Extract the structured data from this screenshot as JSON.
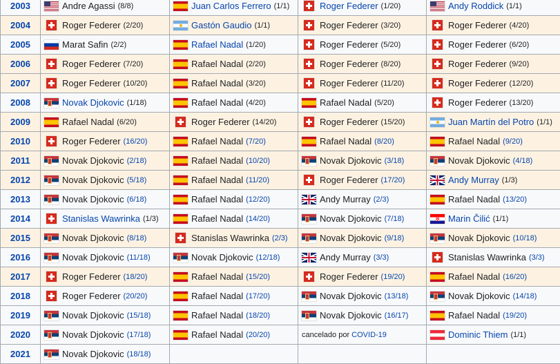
{
  "rows": [
    {
      "year": "2003",
      "cells": [
        {
          "flag": "usa",
          "name": "Andre Agassi",
          "count": "(8/8)",
          "name_link": false,
          "count_link": false
        },
        {
          "flag": "esp",
          "name": "Juan Carlos Ferrero",
          "count": "(1/1)",
          "name_link": true,
          "count_link": false
        },
        {
          "flag": "sui",
          "name": "Roger Federer",
          "count": "(1/20)",
          "name_link": true,
          "count_link": false
        },
        {
          "flag": "usa",
          "name": "Andy Roddick",
          "count": "(1/1)",
          "name_link": true,
          "count_link": false
        }
      ]
    },
    {
      "year": "2004",
      "cells": [
        {
          "flag": "sui",
          "name": "Roger Federer",
          "count": "(2/20)",
          "name_link": false,
          "count_link": false
        },
        {
          "flag": "arg",
          "name": "Gastón Gaudio",
          "count": "(1/1)",
          "name_link": true,
          "count_link": false
        },
        {
          "flag": "sui",
          "name": "Roger Federer",
          "count": "(3/20)",
          "name_link": false,
          "count_link": false
        },
        {
          "flag": "sui",
          "name": "Roger Federer",
          "count": "(4/20)",
          "name_link": false,
          "count_link": false
        }
      ]
    },
    {
      "year": "2005",
      "cells": [
        {
          "flag": "rus",
          "name": "Marat Safin",
          "count": "(2/2)",
          "name_link": false,
          "count_link": false
        },
        {
          "flag": "esp",
          "name": "Rafael Nadal",
          "count": "(1/20)",
          "name_link": true,
          "count_link": false
        },
        {
          "flag": "sui",
          "name": "Roger Federer",
          "count": "(5/20)",
          "name_link": false,
          "count_link": false
        },
        {
          "flag": "sui",
          "name": "Roger Federer",
          "count": "(6/20)",
          "name_link": false,
          "count_link": false
        }
      ]
    },
    {
      "year": "2006",
      "cells": [
        {
          "flag": "sui",
          "name": "Roger Federer",
          "count": "(7/20)",
          "name_link": false,
          "count_link": false
        },
        {
          "flag": "esp",
          "name": "Rafael Nadal",
          "count": "(2/20)",
          "name_link": false,
          "count_link": false
        },
        {
          "flag": "sui",
          "name": "Roger Federer",
          "count": "(8/20)",
          "name_link": false,
          "count_link": false
        },
        {
          "flag": "sui",
          "name": "Roger Federer",
          "count": "(9/20)",
          "name_link": false,
          "count_link": false
        }
      ]
    },
    {
      "year": "2007",
      "cells": [
        {
          "flag": "sui",
          "name": "Roger Federer",
          "count": "(10/20)",
          "name_link": false,
          "count_link": false
        },
        {
          "flag": "esp",
          "name": "Rafael Nadal",
          "count": "(3/20)",
          "name_link": false,
          "count_link": false
        },
        {
          "flag": "sui",
          "name": "Roger Federer",
          "count": "(11/20)",
          "name_link": false,
          "count_link": false
        },
        {
          "flag": "sui",
          "name": "Roger Federer",
          "count": "(12/20)",
          "name_link": false,
          "count_link": false
        }
      ]
    },
    {
      "year": "2008",
      "cells": [
        {
          "flag": "srb",
          "name": "Novak Djokovic",
          "count": "(1/18)",
          "name_link": true,
          "count_link": false
        },
        {
          "flag": "esp",
          "name": "Rafael Nadal",
          "count": "(4/20)",
          "name_link": false,
          "count_link": false
        },
        {
          "flag": "esp",
          "name": "Rafael Nadal",
          "count": "(5/20)",
          "name_link": false,
          "count_link": false
        },
        {
          "flag": "sui",
          "name": "Roger Federer",
          "count": "(13/20)",
          "name_link": false,
          "count_link": false
        }
      ]
    },
    {
      "year": "2009",
      "cells": [
        {
          "flag": "esp",
          "name": "Rafael Nadal",
          "count": "(6/20)",
          "name_link": false,
          "count_link": false
        },
        {
          "flag": "sui",
          "name": "Roger Federer",
          "count": "(14/20)",
          "name_link": false,
          "count_link": false
        },
        {
          "flag": "sui",
          "name": "Roger Federer",
          "count": "(15/20)",
          "name_link": false,
          "count_link": false
        },
        {
          "flag": "arg",
          "name": "Juan Martín del Potro",
          "count": "(1/1)",
          "name_link": true,
          "count_link": false
        }
      ]
    },
    {
      "year": "2010",
      "cells": [
        {
          "flag": "sui",
          "name": "Roger Federer",
          "count": "(16/20)",
          "name_link": false,
          "count_link": true
        },
        {
          "flag": "esp",
          "name": "Rafael Nadal",
          "count": "(7/20)",
          "name_link": false,
          "count_link": true
        },
        {
          "flag": "esp",
          "name": "Rafael Nadal",
          "count": "(8/20)",
          "name_link": false,
          "count_link": true
        },
        {
          "flag": "esp",
          "name": "Rafael Nadal",
          "count": "(9/20)",
          "name_link": false,
          "count_link": true
        }
      ]
    },
    {
      "year": "2011",
      "cells": [
        {
          "flag": "srb",
          "name": "Novak Djokovic",
          "count": "(2/18)",
          "name_link": false,
          "count_link": true
        },
        {
          "flag": "esp",
          "name": "Rafael Nadal",
          "count": "(10/20)",
          "name_link": false,
          "count_link": true
        },
        {
          "flag": "srb",
          "name": "Novak Djokovic",
          "count": "(3/18)",
          "name_link": false,
          "count_link": true
        },
        {
          "flag": "srb",
          "name": "Novak Djokovic",
          "count": "(4/18)",
          "name_link": false,
          "count_link": true
        }
      ]
    },
    {
      "year": "2012",
      "cells": [
        {
          "flag": "srb",
          "name": "Novak Djokovic",
          "count": "(5/18)",
          "name_link": false,
          "count_link": true
        },
        {
          "flag": "esp",
          "name": "Rafael Nadal",
          "count": "(11/20)",
          "name_link": false,
          "count_link": true
        },
        {
          "flag": "sui",
          "name": "Roger Federer",
          "count": "(17/20)",
          "name_link": false,
          "count_link": true
        },
        {
          "flag": "gbr",
          "name": "Andy Murray",
          "count": "(1/3)",
          "name_link": true,
          "count_link": false
        }
      ]
    },
    {
      "year": "2013",
      "cells": [
        {
          "flag": "srb",
          "name": "Novak Djokovic",
          "count": "(6/18)",
          "name_link": false,
          "count_link": true
        },
        {
          "flag": "esp",
          "name": "Rafael Nadal",
          "count": "(12/20)",
          "name_link": false,
          "count_link": true
        },
        {
          "flag": "gbr",
          "name": "Andy Murray",
          "count": "(2/3)",
          "name_link": false,
          "count_link": true
        },
        {
          "flag": "esp",
          "name": "Rafael Nadal",
          "count": "(13/20)",
          "name_link": false,
          "count_link": true
        }
      ]
    },
    {
      "year": "2014",
      "cells": [
        {
          "flag": "sui",
          "name": "Stanislas Wawrinka",
          "count": "(1/3)",
          "name_link": true,
          "count_link": false
        },
        {
          "flag": "esp",
          "name": "Rafael Nadal",
          "count": "(14/20)",
          "name_link": false,
          "count_link": true
        },
        {
          "flag": "srb",
          "name": "Novak Djokovic",
          "count": "(7/18)",
          "name_link": false,
          "count_link": true
        },
        {
          "flag": "cro",
          "name": "Marin Čilić",
          "count": "(1/1)",
          "name_link": true,
          "count_link": false
        }
      ]
    },
    {
      "year": "2015",
      "cells": [
        {
          "flag": "srb",
          "name": "Novak Djokovic",
          "count": "(8/18)",
          "name_link": false,
          "count_link": true
        },
        {
          "flag": "sui",
          "name": "Stanislas Wawrinka",
          "count": "(2/3)",
          "name_link": false,
          "count_link": true
        },
        {
          "flag": "srb",
          "name": "Novak Djokovic",
          "count": "(9/18)",
          "name_link": false,
          "count_link": true
        },
        {
          "flag": "srb",
          "name": "Novak Djokovic",
          "count": "(10/18)",
          "name_link": false,
          "count_link": true
        }
      ]
    },
    {
      "year": "2016",
      "cells": [
        {
          "flag": "srb",
          "name": "Novak Djokovic",
          "count": "(11/18)",
          "name_link": false,
          "count_link": true
        },
        {
          "flag": "srb",
          "name": "Novak Djokovic",
          "count": "(12/18)",
          "name_link": false,
          "count_link": true
        },
        {
          "flag": "gbr",
          "name": "Andy Murray",
          "count": "(3/3)",
          "name_link": false,
          "count_link": true
        },
        {
          "flag": "sui",
          "name": "Stanislas Wawrinka",
          "count": "(3/3)",
          "name_link": false,
          "count_link": true
        }
      ]
    },
    {
      "year": "2017",
      "cells": [
        {
          "flag": "sui",
          "name": "Roger Federer",
          "count": "(18/20)",
          "name_link": false,
          "count_link": true
        },
        {
          "flag": "esp",
          "name": "Rafael Nadal",
          "count": "(15/20)",
          "name_link": false,
          "count_link": true
        },
        {
          "flag": "sui",
          "name": "Roger Federer",
          "count": "(19/20)",
          "name_link": false,
          "count_link": true
        },
        {
          "flag": "esp",
          "name": "Rafael Nadal",
          "count": "(16/20)",
          "name_link": false,
          "count_link": true
        }
      ]
    },
    {
      "year": "2018",
      "cells": [
        {
          "flag": "sui",
          "name": "Roger Federer",
          "count": "(20/20)",
          "name_link": false,
          "count_link": true
        },
        {
          "flag": "esp",
          "name": "Rafael Nadal",
          "count": "(17/20)",
          "name_link": false,
          "count_link": true
        },
        {
          "flag": "srb",
          "name": "Novak Djokovic",
          "count": "(13/18)",
          "name_link": false,
          "count_link": true
        },
        {
          "flag": "srb",
          "name": "Novak Djokovic",
          "count": "(14/18)",
          "name_link": false,
          "count_link": true
        }
      ]
    },
    {
      "year": "2019",
      "cells": [
        {
          "flag": "srb",
          "name": "Novak Djokovic",
          "count": "(15/18)",
          "name_link": false,
          "count_link": true
        },
        {
          "flag": "esp",
          "name": "Rafael Nadal",
          "count": "(18/20)",
          "name_link": false,
          "count_link": true
        },
        {
          "flag": "srb",
          "name": "Novak Djokovic",
          "count": "(16/17)",
          "name_link": false,
          "count_link": true
        },
        {
          "flag": "esp",
          "name": "Rafael Nadal",
          "count": "(19/20)",
          "name_link": false,
          "count_link": true
        }
      ]
    },
    {
      "year": "2020",
      "cells": [
        {
          "flag": "srb",
          "name": "Novak Djokovic",
          "count": "(17/18)",
          "name_link": false,
          "count_link": true
        },
        {
          "flag": "esp",
          "name": "Rafael Nadal",
          "count": "(20/20)",
          "name_link": false,
          "count_link": true
        },
        {
          "cancel_text": "cancelado por ",
          "cancel_link": "COVID-19"
        },
        {
          "flag": "aut",
          "name": "Dominic Thiem",
          "count": "(1/1)",
          "name_link": true,
          "count_link": false
        }
      ]
    },
    {
      "year": "2021",
      "cells": [
        {
          "flag": "srb",
          "name": "Novak Djokovic",
          "count": "(18/18)",
          "name_link": false,
          "count_link": true
        },
        null,
        null,
        null
      ]
    }
  ],
  "colors": {
    "link": "#0645ad",
    "border": "#a2a9b1",
    "alt_row": "#fdf2e2",
    "plain_row": "#f8f9fa"
  }
}
